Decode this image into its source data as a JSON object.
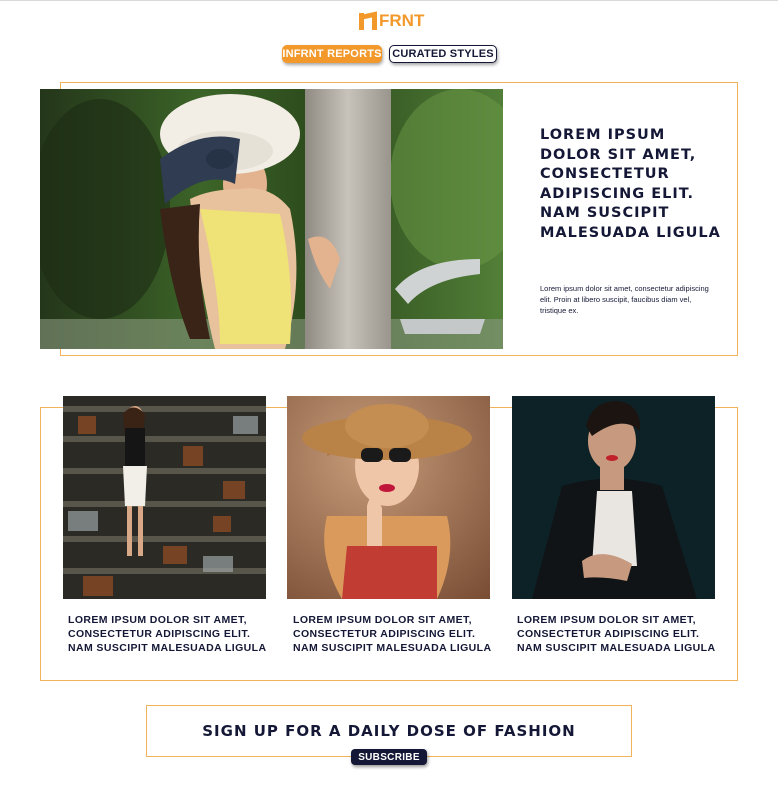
{
  "brand": {
    "logo_text": "INFRNT",
    "logo_visible_text": "FRNT",
    "accent_color": "#f3992b",
    "navy_color": "#141836"
  },
  "nav": {
    "tabs": [
      {
        "label": "INFRNT REPORTS",
        "active": true
      },
      {
        "label": "CURATED STYLES",
        "active": false
      }
    ]
  },
  "hero": {
    "image_icon": "hero-photo",
    "title": "LOREM IPSUM DOLOR SIT AMET, CONSECTETUR ADIPISCING ELIT. NAM SUSCIPIT MALESUADA LIGULA",
    "body": "Lorem ipsum dolor sit amet, consectetur adipiscing elit.  Proin at libero suscipit, faucibus diam vel, tristique ex."
  },
  "cards": [
    {
      "image_icon": "card-photo-1",
      "caption": "LOREM IPSUM DOLOR SIT AMET, CONSECTETUR ADIPISCING ELIT. NAM SUSCIPIT  MALESUADA LIGULA"
    },
    {
      "image_icon": "card-photo-2",
      "caption": "LOREM IPSUM DOLOR SIT AMET, CONSECTETUR ADIPISCING ELIT. NAM SUSCIPIT  MALESUADA LIGULA"
    },
    {
      "image_icon": "card-photo-3",
      "caption": "LOREM IPSUM DOLOR SIT AMET, CONSECTETUR ADIPISCING ELIT. NAM SUSCIPIT  MALESUADA LIGULA"
    }
  ],
  "signup": {
    "headline": "SIGN UP FOR A DAILY DOSE OF FASHION",
    "button_label": "SUBSCRIBE"
  }
}
